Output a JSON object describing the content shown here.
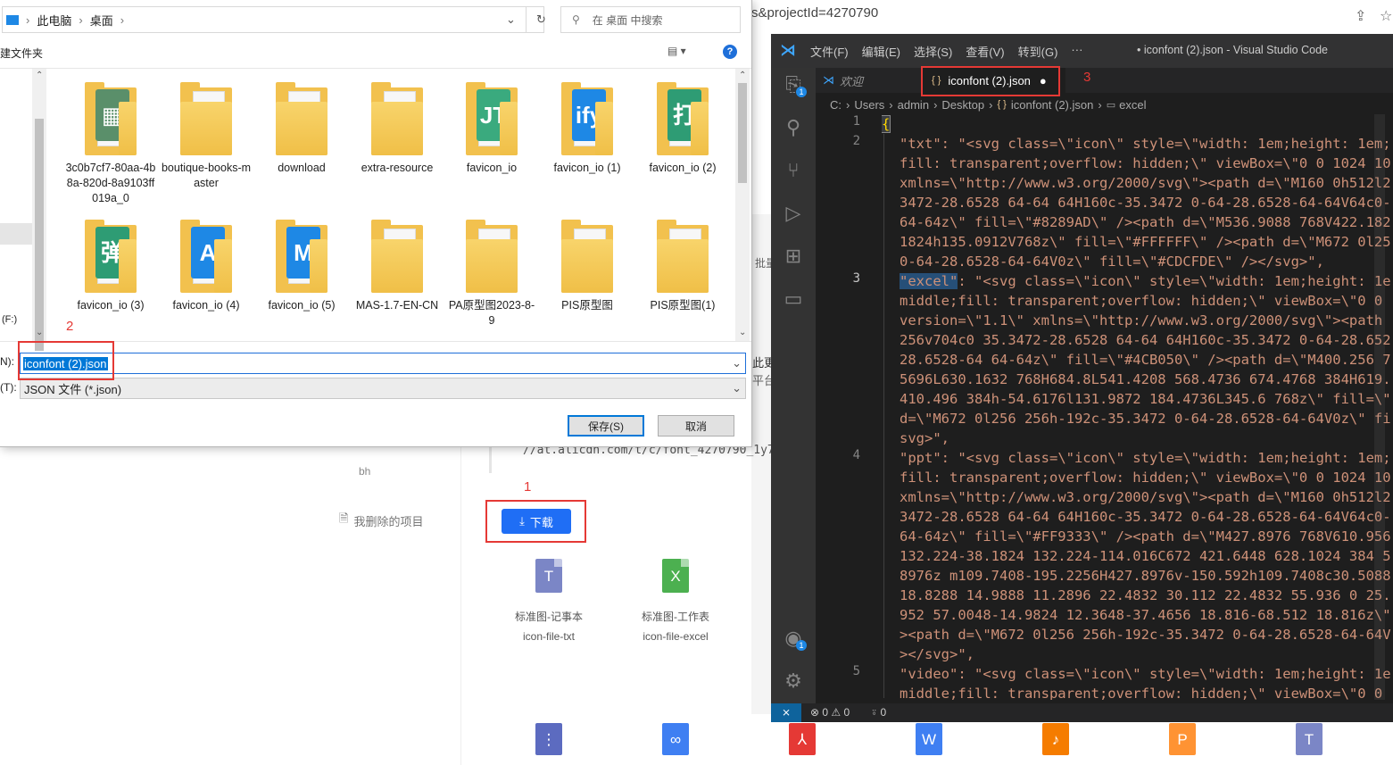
{
  "browser": {
    "url_fragment": "s&projectId=4270790",
    "cdn_text": "//at.alicdn.com/t/c/font_4270790_1y7",
    "side_partial_1": "此更",
    "side_partial_2": "平台",
    "side_partial_3": "批量",
    "bh_text": "bh",
    "deleted_projects": "我删除的项目",
    "download_button": "下载",
    "files": [
      {
        "title": "标准图-记事本",
        "code": "icon-file-txt",
        "letter": "T",
        "color": "#7b86c6"
      },
      {
        "title": "标准图-工作表",
        "code": "icon-file-excel",
        "letter": "X",
        "color": "#4cb050"
      }
    ],
    "bottom_icons": [
      {
        "letter": "⋮",
        "color": "#5c6bc0",
        "name": "zip-file-icon"
      },
      {
        "letter": "∞",
        "color": "#3f7ff2",
        "name": "link-file-icon"
      },
      {
        "letter": "⅄",
        "color": "#e53935",
        "name": "pdf-file-icon"
      },
      {
        "letter": "W",
        "color": "#3f7ff2",
        "name": "word-file-icon"
      },
      {
        "letter": "♪",
        "color": "#f57c00",
        "name": "audio-file-icon"
      },
      {
        "letter": "P",
        "color": "#ff9333",
        "name": "ppt-file-icon"
      },
      {
        "letter": "T",
        "color": "#7b86c6",
        "name": "txt-file-icon"
      }
    ]
  },
  "annotations": {
    "n1": "1",
    "n2": "2",
    "n3": "3"
  },
  "dialog": {
    "breadcrumb": [
      "此电脑",
      "桌面"
    ],
    "search_placeholder": "在 桌面 中搜索",
    "new_folder": "建文件夹",
    "side_drive": "(F:)",
    "folders_row1": [
      {
        "name": "3c0b7cf7-80aa-4b8a-820d-8a9103ff019a_0",
        "thumb": "#5a8f6a",
        "glyph": "▦"
      },
      {
        "name": "boutique-books-master",
        "thumb": "",
        "glyph": ""
      },
      {
        "name": "download",
        "thumb": "",
        "glyph": ""
      },
      {
        "name": "extra-resource",
        "thumb": "",
        "glyph": ""
      },
      {
        "name": "favicon_io",
        "thumb": "#3aaa7e",
        "glyph": "JT"
      },
      {
        "name": "favicon_io (1)",
        "thumb": "#1e88e5",
        "glyph": "ify"
      },
      {
        "name": "favicon_io (2)",
        "thumb": "#2e9c74",
        "glyph": "打"
      }
    ],
    "folders_row2": [
      {
        "name": "favicon_io (3)",
        "thumb": "#2e9c74",
        "glyph": "弹"
      },
      {
        "name": "favicon_io (4)",
        "thumb": "#1e88e5",
        "glyph": "A"
      },
      {
        "name": "favicon_io (5)",
        "thumb": "#1e88e5",
        "glyph": "M"
      },
      {
        "name": "MAS-1.7-EN-CN",
        "thumb": "",
        "glyph": ""
      },
      {
        "name": "PA原型图2023-8-9",
        "thumb": "",
        "glyph": ""
      },
      {
        "name": "PIS原型图",
        "thumb": "",
        "glyph": ""
      },
      {
        "name": "PIS原型图(1)",
        "thumb": "",
        "glyph": ""
      }
    ],
    "filename_label": "N):",
    "filename_value": "iconfont (2).json",
    "filetype_label": "(T):",
    "filetype_value": "JSON 文件 (*.json)",
    "save_button": "保存(S)",
    "cancel_button": "取消"
  },
  "vscode": {
    "menu": [
      "文件(F)",
      "编辑(E)",
      "选择(S)",
      "查看(V)",
      "转到(G)",
      "···"
    ],
    "window_title": "• iconfont (2).json - Visual Studio Code",
    "tab_welcome": "欢迎",
    "tab_file": "iconfont (2).json",
    "breadcrumb": [
      "C:",
      "Users",
      "admin",
      "Desktop",
      "iconfont (2).json",
      "excel"
    ],
    "line_numbers": [
      "1",
      "2",
      "3",
      "4",
      "5"
    ],
    "code_lines": [
      {
        "key": "{",
        "val": ""
      },
      {
        "key": "\"txt\"",
        "val": ": \"<svg class=\\\"icon\\\" style=\\\"width: 1em;height: 1em;"
      },
      {
        "key": "",
        "val": "fill: transparent;overflow: hidden;\\\" viewBox=\\\"0 0 1024 10"
      },
      {
        "key": "",
        "val": "xmlns=\\\"http://www.w3.org/2000/svg\\\"><path d=\\\"M160 0h512l2"
      },
      {
        "key": "",
        "val": "3472-28.6528 64-64 64H160c-35.3472 0-64-28.6528-64-64V64c0-"
      },
      {
        "key": "",
        "val": "64-64z\\\" fill=\\\"#8289AD\\\" /><path d=\\\"M536.9088 768V422.182"
      },
      {
        "key": "",
        "val": "1824h135.0912V768z\\\" fill=\\\"#FFFFFF\\\" /><path d=\\\"M672 0l25"
      },
      {
        "key": "",
        "val": "0-64-28.6528-64-64V0z\\\" fill=\\\"#CDCFDE\\\" /></svg>\","
      },
      {
        "key": "\"excel\"",
        "val": ": \"<svg class=\\\"icon\\\" style=\\\"width: 1em;height: 1e"
      },
      {
        "key": "",
        "val": "middle;fill: transparent;overflow: hidden;\\\" viewBox=\\\"0 0"
      },
      {
        "key": "",
        "val": "version=\\\"1.1\\\" xmlns=\\\"http://www.w3.org/2000/svg\\\"><path"
      },
      {
        "key": "",
        "val": "256v704c0 35.3472-28.6528 64-64 64H160c-35.3472 0-64-28.652"
      },
      {
        "key": "",
        "val": "28.6528-64 64-64z\\\" fill=\\\"#4CB050\\\" /><path d=\\\"M400.256 7"
      },
      {
        "key": "",
        "val": "5696L630.1632 768H684.8L541.4208 568.4736 674.4768 384H619."
      },
      {
        "key": "",
        "val": "410.496 384h-54.6176l131.9872 184.4736L345.6 768z\\\" fill=\\\""
      },
      {
        "key": "",
        "val": "d=\\\"M672 0l256 256h-192c-35.3472 0-64-28.6528-64-64V0z\\\" fi"
      },
      {
        "key": "",
        "val": "svg>\","
      },
      {
        "key": "\"ppt\"",
        "val": ": \"<svg class=\\\"icon\\\" style=\\\"width: 1em;height: 1em;"
      },
      {
        "key": "",
        "val": "fill: transparent;overflow: hidden;\\\" viewBox=\\\"0 0 1024 10"
      },
      {
        "key": "",
        "val": "xmlns=\\\"http://www.w3.org/2000/svg\\\"><path d=\\\"M160 0h512l2"
      },
      {
        "key": "",
        "val": "3472-28.6528 64-64 64H160c-35.3472 0-64-28.6528-64-64V64c0-"
      },
      {
        "key": "",
        "val": "64-64z\\\" fill=\\\"#FF9333\\\" /><path d=\\\"M427.8976 768V610.956"
      },
      {
        "key": "",
        "val": "132.224-38.1824 132.224-114.016C672 421.6448 628.1024 384 5"
      },
      {
        "key": "",
        "val": "8976z m109.7408-195.2256H427.8976v-150.592h109.7408c30.5088"
      },
      {
        "key": "",
        "val": "18.8288 14.9888 11.2896 22.4832 30.112 22.4832 55.936 0 25."
      },
      {
        "key": "",
        "val": "952 57.0048-14.9824 12.3648-37.4656 18.816-68.512 18.816z\\\""
      },
      {
        "key": "",
        "val": "><path d=\\\"M672 0l256 256h-192c-35.3472 0-64-28.6528-64-64V"
      },
      {
        "key": "",
        "val": "></svg>\","
      },
      {
        "key": "\"video\"",
        "val": ": \"<svg class=\\\"icon\\\" style=\\\"width: 1em;height: 1e"
      },
      {
        "key": "",
        "val": "middle;fill: transparent;overflow: hidden;\\\" viewBox=\\\"0 0"
      }
    ],
    "status_errors": "⊗ 0 ⚠ 0",
    "status_ports": "⍤ 0",
    "badge_count": "1"
  }
}
